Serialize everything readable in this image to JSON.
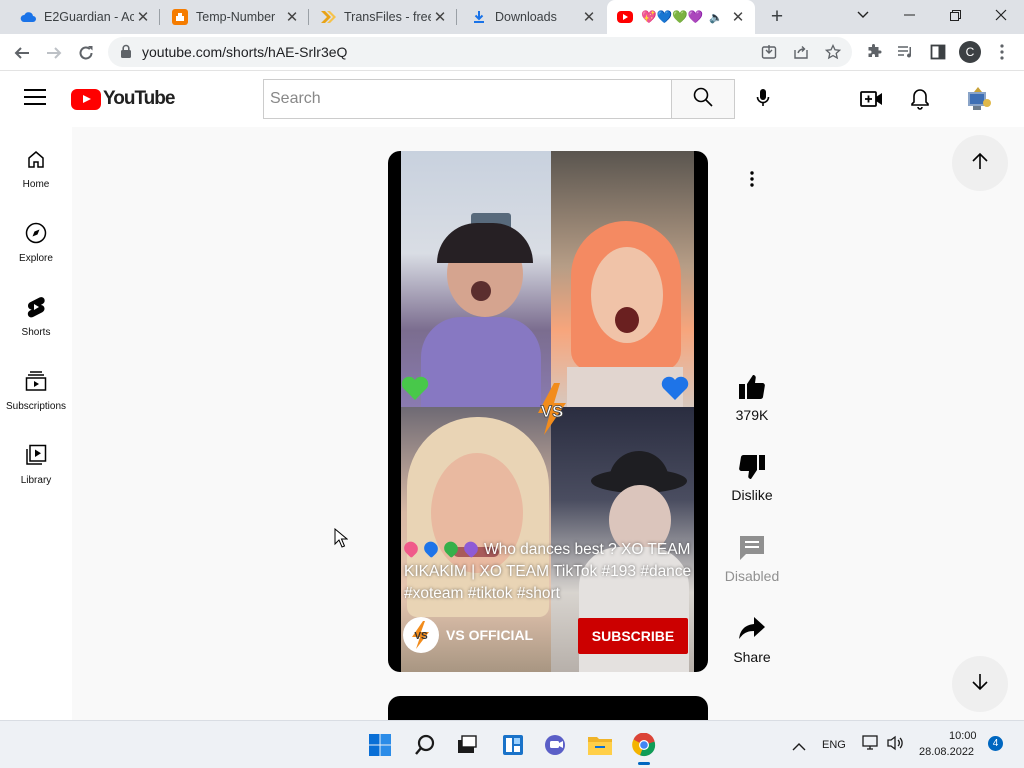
{
  "browser": {
    "tabs": [
      {
        "title": "E2Guardian - Ac",
        "favicon": "e2guardian-cloud-icon",
        "color": "#1a73e8"
      },
      {
        "title": "Temp-Number",
        "favicon": "temp-number-icon",
        "color": "#f57c00"
      },
      {
        "title": "TransFiles - free",
        "favicon": "transfiles-icon",
        "color": "#f9a825"
      },
      {
        "title": "Downloads",
        "favicon": "download-icon",
        "color": "#1a73e8"
      },
      {
        "title": "💖💙💚💜",
        "favicon": "youtube-icon",
        "color": "#ff0000",
        "active": true
      }
    ],
    "url": "youtube.com/shorts/hAE-Srlr3eQ",
    "profile_initial": "C"
  },
  "youtube": {
    "logo_text": "YouTube",
    "search_placeholder": "Search",
    "guide": [
      {
        "label": "Home",
        "icon": "home-icon"
      },
      {
        "label": "Explore",
        "icon": "compass-icon"
      },
      {
        "label": "Shorts",
        "icon": "shorts-icon"
      },
      {
        "label": "Subscriptions",
        "icon": "subscriptions-icon"
      },
      {
        "label": "Library",
        "icon": "library-icon"
      }
    ],
    "short": {
      "caption": "Who dances best ? XO TEAM KIKAKIM | XO TEAM TikTok #193 #dance #xoteam #tiktok #short",
      "channel": "VS OFFICIAL",
      "subscribe_label": "SUBSCRIBE",
      "badge_text": "VS"
    },
    "actions": {
      "like": "379K",
      "dislike": "Dislike",
      "comments": "Disabled",
      "share": "Share"
    },
    "colors": {
      "brand_red": "#ff0000",
      "subscribe_red": "#cc0000"
    }
  },
  "taskbar": {
    "language": "ENG",
    "time": "10:00",
    "date": "28.08.2022",
    "notification_count": "4"
  }
}
